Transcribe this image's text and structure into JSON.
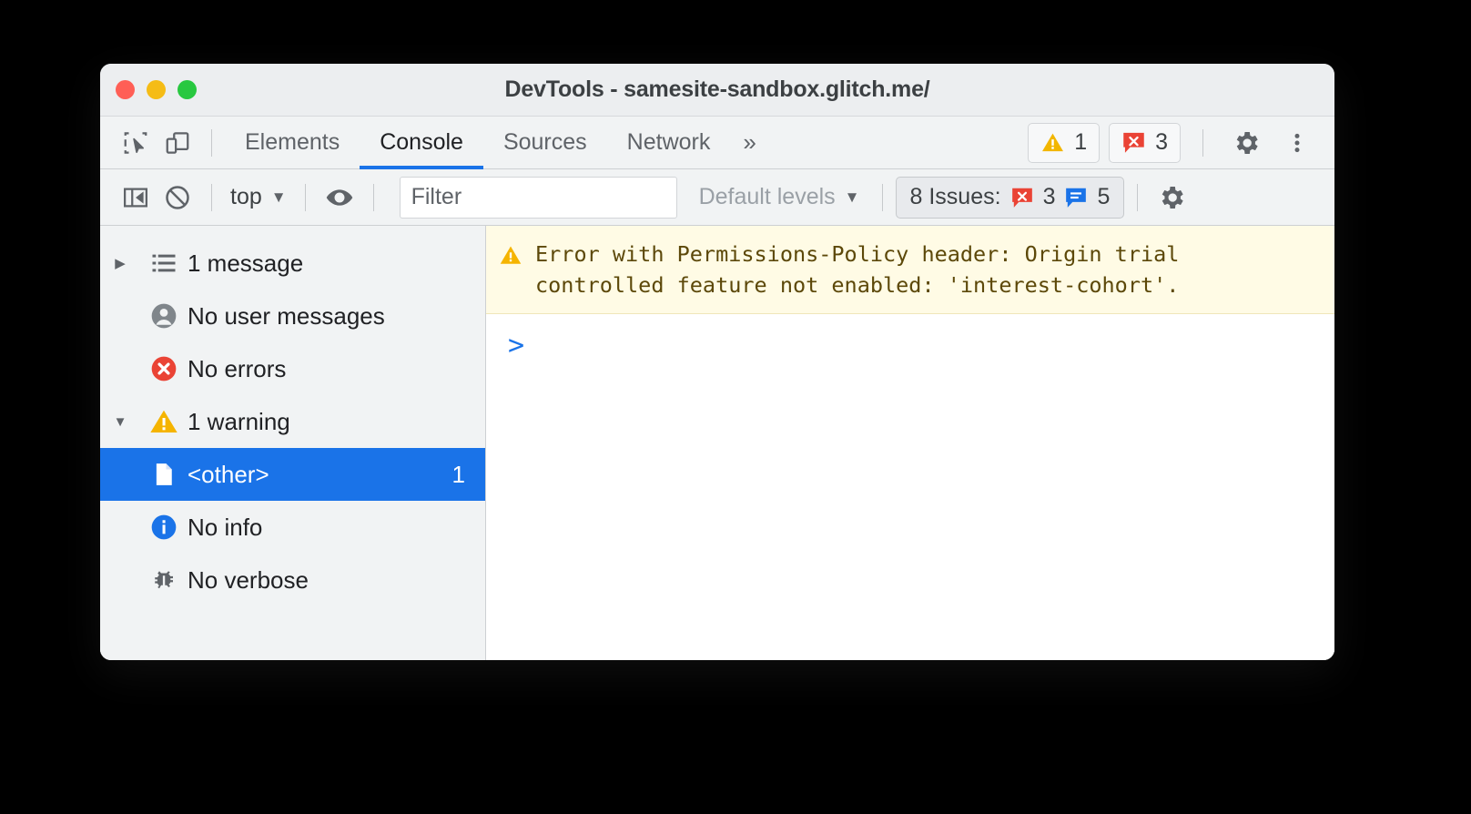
{
  "window": {
    "title": "DevTools - samesite-sandbox.glitch.me/",
    "traffic_lights": [
      {
        "name": "close",
        "color": "#ff5f56"
      },
      {
        "name": "minimize",
        "color": "#f5bc16"
      },
      {
        "name": "maximize",
        "color": "#28c840"
      }
    ]
  },
  "tabbar": {
    "inspect_icon": "inspect-element-icon",
    "device_icon": "device-toolbar-icon",
    "tabs": [
      {
        "label": "Elements",
        "active": false
      },
      {
        "label": "Console",
        "active": true
      },
      {
        "label": "Sources",
        "active": false
      },
      {
        "label": "Network",
        "active": false
      }
    ],
    "overflow_label": "»",
    "warning_count": "1",
    "error_count": "3",
    "settings_icon": "gear-icon",
    "more_icon": "kebab-menu-icon"
  },
  "filterbar": {
    "sidebar_toggle_icon": "sidebar-toggle-icon",
    "clear_console_icon": "clear-console-icon",
    "context_label": "top",
    "context_caret": "▼",
    "live_expression_icon": "eye-icon",
    "filter_placeholder": "Filter",
    "filter_value": "",
    "levels_label": "Default levels",
    "levels_caret": "▼",
    "issues_label": "8 Issues:",
    "issues_error_count": "3",
    "issues_info_count": "5",
    "settings_icon": "gear-icon"
  },
  "sidebar": {
    "rows": [
      {
        "label": "1 message",
        "icon": "list-icon",
        "twisty": "▶",
        "count": "",
        "selected": false,
        "indent": false
      },
      {
        "label": "No user messages",
        "icon": "person-icon",
        "twisty": "",
        "count": "",
        "selected": false,
        "indent": false
      },
      {
        "label": "No errors",
        "icon": "error-circle-icon",
        "twisty": "",
        "count": "",
        "selected": false,
        "indent": false
      },
      {
        "label": "1 warning",
        "icon": "warning-triangle-icon",
        "twisty": "▼",
        "count": "",
        "selected": false,
        "indent": false
      },
      {
        "label": "<other>",
        "icon": "document-icon",
        "twisty": "",
        "count": "1",
        "selected": true,
        "indent": true
      },
      {
        "label": "No info",
        "icon": "info-circle-icon",
        "twisty": "",
        "count": "",
        "selected": false,
        "indent": false
      },
      {
        "label": "No verbose",
        "icon": "bug-icon",
        "twisty": "",
        "count": "",
        "selected": false,
        "indent": false
      }
    ]
  },
  "console": {
    "messages": [
      {
        "level": "warning",
        "icon": "warning-triangle-icon",
        "text": "Error with Permissions-Policy header: Origin trial\ncontrolled feature not enabled: 'interest-cohort'."
      }
    ],
    "prompt_caret": ">",
    "prompt_value": ""
  },
  "colors": {
    "accent": "#1a73e8",
    "warning": "#f2b600",
    "error": "#ea4335",
    "info": "#1a73e8",
    "warning_bg": "#fffbe5",
    "panel_bg": "#f1f3f4"
  }
}
